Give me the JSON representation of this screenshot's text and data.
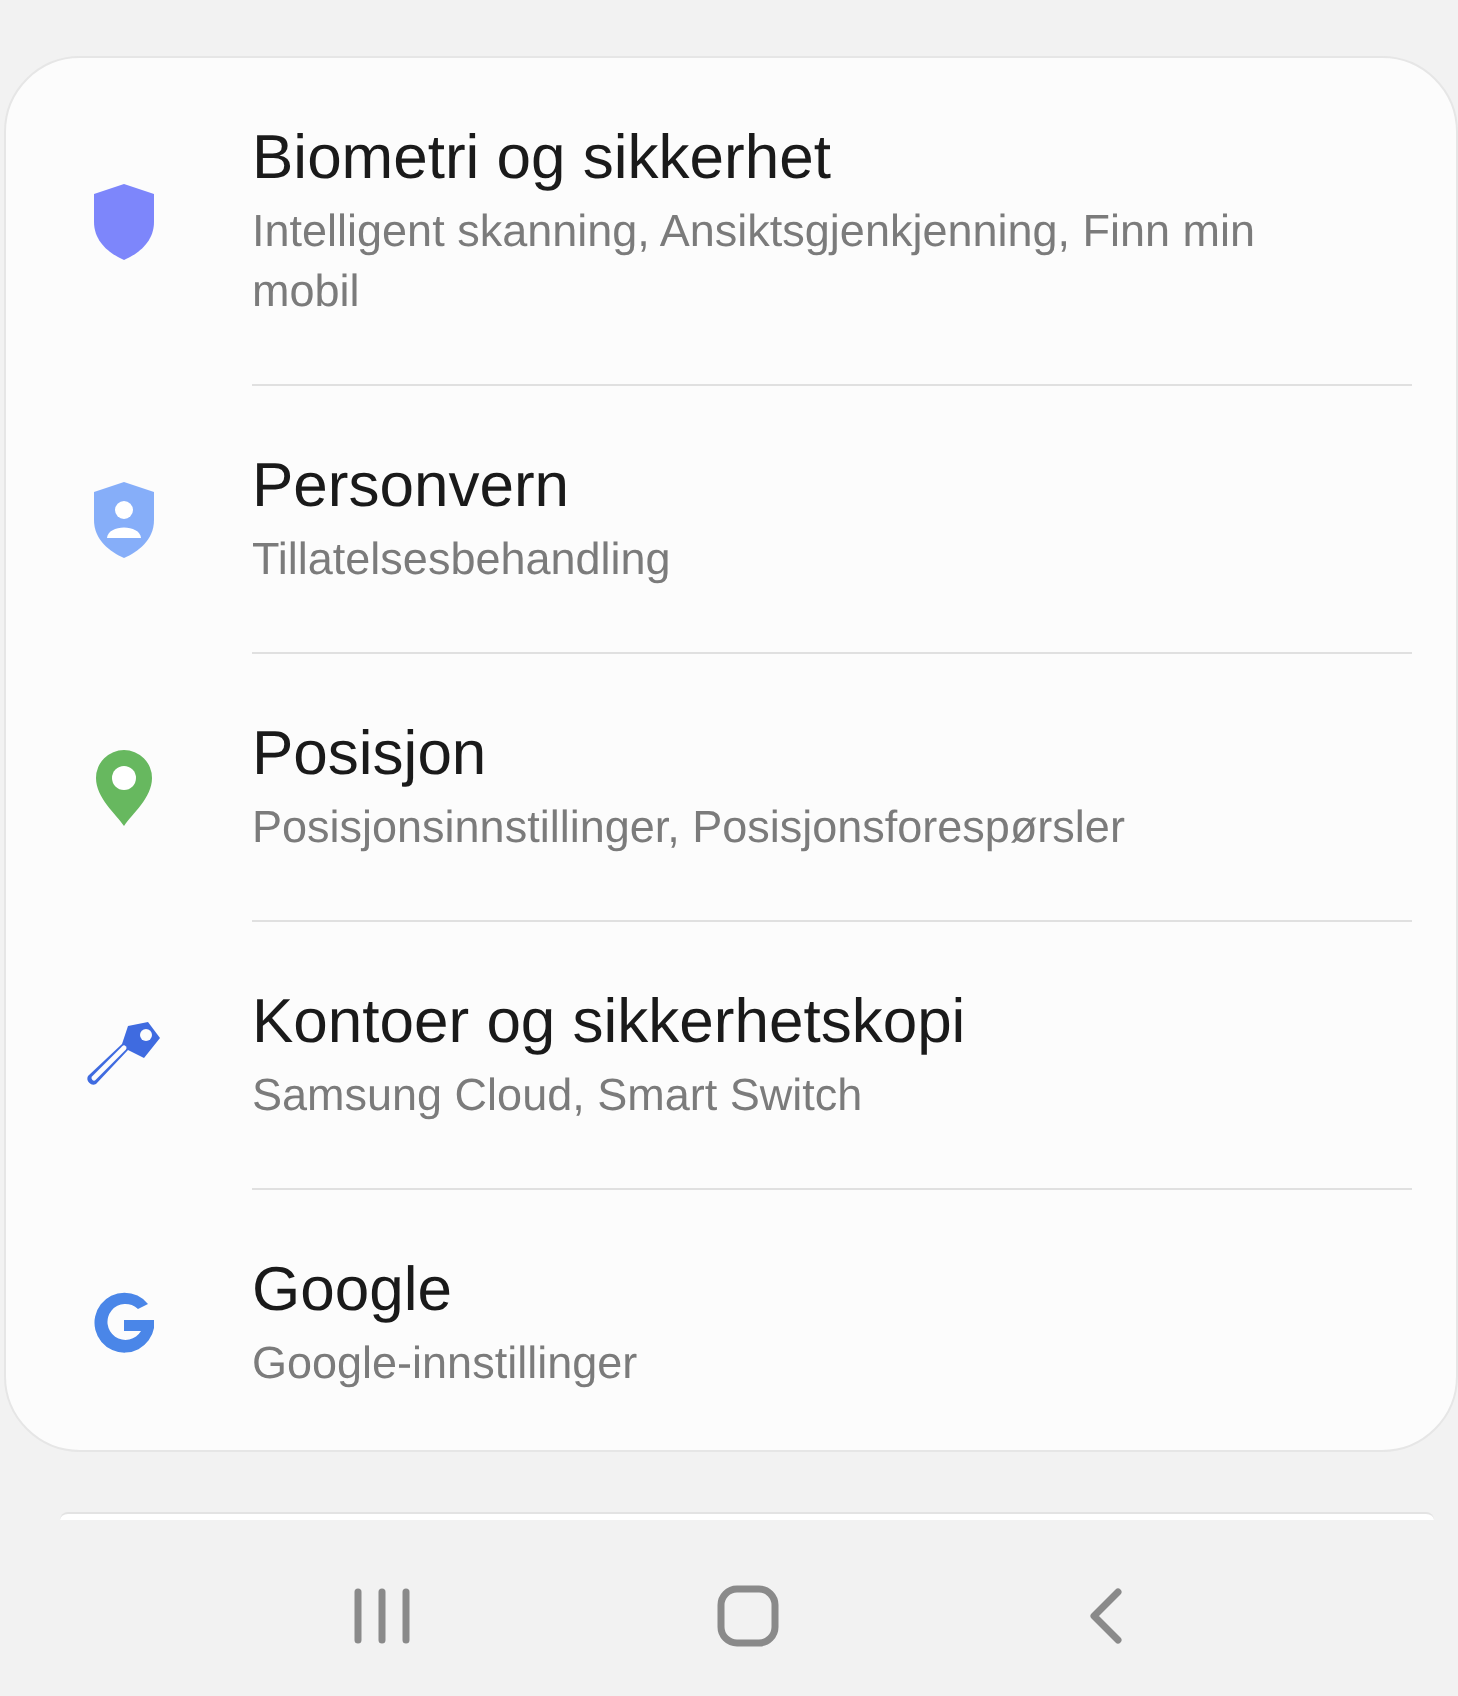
{
  "settings": [
    {
      "title": "Biometri og sikkerhet",
      "subtitle": "Intelligent skanning, Ansiktsgjenkjenning, Finn min mobil"
    },
    {
      "title": "Personvern",
      "subtitle": "Tillatelsesbehandling"
    },
    {
      "title": "Posisjon",
      "subtitle": "Posisjonsinnstillinger, Posisjonsforespørsler"
    },
    {
      "title": "Kontoer og sikkerhetskopi",
      "subtitle": "Samsung Cloud, Smart Switch"
    },
    {
      "title": "Google",
      "subtitle": "Google-innstillinger"
    }
  ]
}
